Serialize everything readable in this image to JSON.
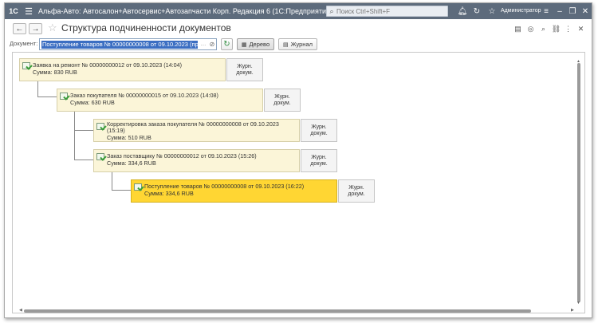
{
  "app": {
    "logo": "1C",
    "title": "Альфа-Авто: Автосалон+Автосервис+Автозапчасти Корп. Редакция 6  (1С:Предприятие)",
    "search_placeholder": "Поиск Ctrl+Shift+F",
    "user": "Администратор"
  },
  "form": {
    "title": "Структура подчиненности документов",
    "document_label": "Документ:",
    "document_value": "Поступление товаров № 00000000008 от 09.10.2023 (провед",
    "tree_button": "Дерево",
    "journal_button": "Журнал"
  },
  "nodes": [
    {
      "title": "Заявка на ремонт № 00000000012 от 09.10.2023 (14:04)",
      "sum": "Сумма: 830 RUB",
      "journal": "Журн. докум."
    },
    {
      "title": "Заказ покупателя № 00000000015 от 09.10.2023 (14:08)",
      "sum": "Сумма: 630 RUB",
      "journal": "Журн. докум."
    },
    {
      "title": "Корректировка заказа покупателя № 00000000008 от 09.10.2023 (15:19)",
      "sum": "Сумма: 510 RUB",
      "journal": "Журн. докум."
    },
    {
      "title": "Заказ поставщику № 00000000012 от 09.10.2023 (15:26)",
      "sum": "Сумма: 334,6 RUB",
      "journal": "Журн. докум."
    },
    {
      "title": "Поступление товаров № 00000000008 от 09.10.2023 (16:22)",
      "sum": "Сумма: 334,6 RUB",
      "journal": "Журн. докум."
    }
  ],
  "colors": {
    "titlebar": "#5d6b7c",
    "node_bg": "#fbf5d8",
    "node_selected_bg": "#ffd633",
    "field_selection": "#3b6ec2"
  },
  "icons": {
    "back": "arrow-left-icon",
    "forward": "arrow-right-icon",
    "favorite": "star-icon",
    "bell": "bell-icon",
    "history": "history-icon",
    "favorites_top": "star-icon",
    "settings": "settings-icon",
    "minimize": "minimize-icon",
    "restore": "restore-icon",
    "close": "close-icon"
  }
}
